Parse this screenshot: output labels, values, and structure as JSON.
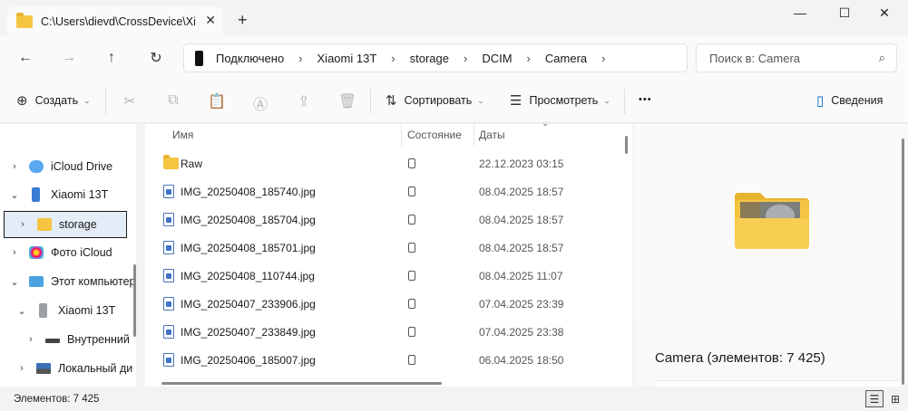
{
  "window": {
    "tab_title": "C:\\Users\\dievd\\CrossDevice\\Xi",
    "tab_close": "✕",
    "new_tab": "+",
    "minimize": "—",
    "maximize": "☐",
    "close": "✕"
  },
  "nav": {
    "back": "←",
    "forward": "→",
    "up": "↑",
    "refresh": "↻",
    "breadcrumbs": [
      "Подключено",
      "Xiaomi 13T",
      "storage",
      "DCIM",
      "Camera"
    ],
    "separator": "›",
    "search_placeholder": "Поиск в: Camera",
    "search_icon": "⌕"
  },
  "toolbar": {
    "create_label": "Создать",
    "sort_label": "Сортировать",
    "view_label": "Просмотреть",
    "more_label": "•••",
    "details_label": "Сведения",
    "icons": {
      "create": "⊕",
      "cut": "✂",
      "copy": "⧉",
      "paste": "📋",
      "rename": "Ⓐ",
      "share": "⇪",
      "delete": "🗑",
      "sort": "⇅",
      "view": "☰",
      "details": "▯"
    }
  },
  "sidebar": {
    "items": [
      {
        "label": "iCloud Drive",
        "icon": "cloud-icon"
      },
      {
        "label": "Xiaomi 13T",
        "icon": "phone-icon"
      },
      {
        "label": "storage",
        "icon": "folder-icon"
      },
      {
        "label": "Фото iCloud",
        "icon": "photos-icon"
      },
      {
        "label": "Этот компьютер",
        "icon": "computer-icon"
      },
      {
        "label": "Xiaomi 13T",
        "icon": "phone-icon"
      },
      {
        "label": "Внутренний",
        "icon": "drive-icon"
      },
      {
        "label": "Локальный ди",
        "icon": "disk-icon"
      }
    ],
    "chevron_right": "›",
    "chevron_down": "⌄"
  },
  "filelist": {
    "columns": {
      "name": "Имя",
      "status": "Состояние",
      "date": "Даты"
    },
    "rows": [
      {
        "name": "Raw",
        "date": "22.12.2023 03:15",
        "type": "folder"
      },
      {
        "name": "IMG_20250408_185740.jpg",
        "date": "08.04.2025 18:57",
        "type": "jpg"
      },
      {
        "name": "IMG_20250408_185704.jpg",
        "date": "08.04.2025 18:57",
        "type": "jpg"
      },
      {
        "name": "IMG_20250408_185701.jpg",
        "date": "08.04.2025 18:57",
        "type": "jpg"
      },
      {
        "name": "IMG_20250408_110744.jpg",
        "date": "08.04.2025 11:07",
        "type": "jpg"
      },
      {
        "name": "IMG_20250407_233906.jpg",
        "date": "07.04.2025 23:39",
        "type": "jpg"
      },
      {
        "name": "IMG_20250407_233849.jpg",
        "date": "07.04.2025 23:38",
        "type": "jpg"
      },
      {
        "name": "IMG_20250406_185007.jpg",
        "date": "06.04.2025 18:50",
        "type": "jpg"
      }
    ]
  },
  "details": {
    "title": "Camera (элементов: 7 425)"
  },
  "statusbar": {
    "count": "Элементов: 7 425",
    "details_view_icon": "☰",
    "tiles_view_icon": "⊞"
  },
  "colors": {
    "accent": "#0067c0",
    "folder": "#f5c542",
    "selection": "#e4ecf7"
  }
}
